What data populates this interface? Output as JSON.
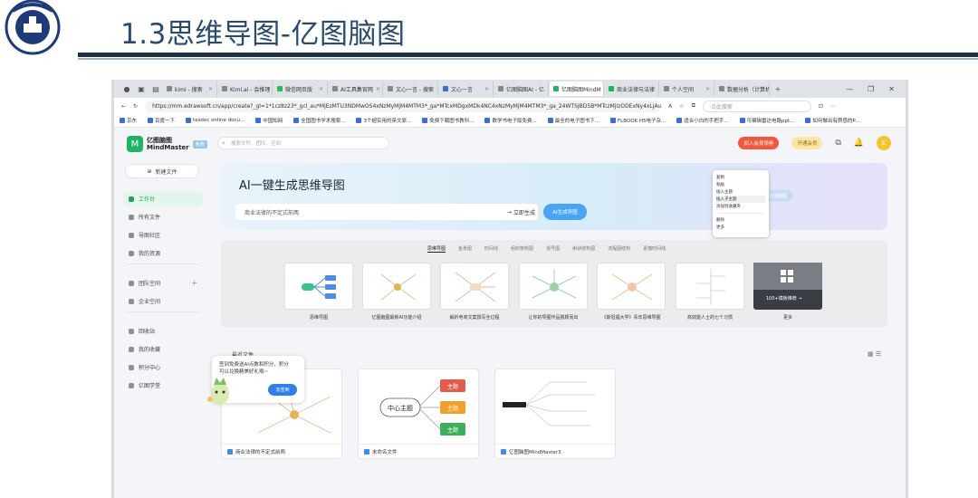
{
  "slide": {
    "title": "1.3思维导图-亿图脑图"
  },
  "browser": {
    "tabs": [
      {
        "label": "kimi - 搜索"
      },
      {
        "label": "Kimi.ai - 会推理"
      },
      {
        "label": "微信网页版"
      },
      {
        "label": "AI工具集官网"
      },
      {
        "label": "文心一言 - 搜索"
      },
      {
        "label": "文心一言"
      },
      {
        "label": "亿图脑图AI - 亿"
      },
      {
        "label": "亿图脑图MindM",
        "active": true
      },
      {
        "label": "商业法律与法律"
      },
      {
        "label": "个人空间"
      },
      {
        "label": "数据分析（计算机"
      }
    ],
    "url": "https://mm.edrawsoft.cn/app/create?_gl=1*1cz8z23*_gcl_au*MjEzMTU3NDMwOS4xNzMyMjM4MTM3*_ga*MTcxMDgxMDk4NC4xNzMyMjM4MTM3*_ga_24WTSJBD5B*MTczMjIzODExNy4xLjAuMTcz...",
    "find_placeholder": "点此搜索",
    "bookmarks": [
      "京东",
      "百度一下",
      "tesdoc online docu...",
      "中国知网",
      "全国图书学术搜索...",
      "3个超实用的英文原...",
      "免费下载图书教科...",
      "数学书电子版免费...",
      "最全的电子图书下...",
      "FLBOOK·H5电子杂...",
      "适合小白的手把手...",
      "可编辑雷达电路ppt...",
      "如何做出有质感的P..."
    ]
  },
  "app": {
    "brand_name": "亿图脑图\nMindMaster",
    "brand_tag": "免费",
    "search_placeholder": "搜索文件、团队、空间",
    "top_right": {
      "upgrade_label": "加入会员领券",
      "member_label": "开通会员",
      "avatar_letter": "E"
    },
    "sidebar": {
      "new_file": "新建文件",
      "items": [
        {
          "label": "工作台",
          "active": true
        },
        {
          "label": "所有文件"
        },
        {
          "label": "导图社区"
        },
        {
          "label": "我的资源"
        },
        {
          "label": "团队空间"
        },
        {
          "label": "企业空间"
        },
        {
          "label": "回收站"
        },
        {
          "label": "我的收藏"
        },
        {
          "label": "积分中心"
        },
        {
          "label": "亿图学堂"
        }
      ]
    },
    "banner": {
      "title": "AI一键生成思维导图",
      "prompt_value": "商业法律的不定式前两",
      "generate_label": "立即生成",
      "ai_button": "AI生成导图",
      "side_button": "亿图脑图"
    },
    "context_menu": [
      "复制",
      "粘贴",
      "插入主题",
      "插入子主题",
      "添加到收藏夹",
      "删除",
      "更多"
    ],
    "template_tabs": [
      "思维导图",
      "鱼骨图",
      "时间线",
      "组织架构图",
      "括号图",
      "树状结构图",
      "流程图结构",
      "素描时间线"
    ],
    "templates": [
      {
        "label": "思维导图"
      },
      {
        "label": "亿图脑图最新AI功能介绍"
      },
      {
        "label": "解析电商文案撰写全过程"
      },
      {
        "label": "让你的导图作品脱颖而出"
      },
      {
        "label": "《斯坦福大学》青年思维导图"
      },
      {
        "label": "高效能人士的七个习惯"
      },
      {
        "label": "更多",
        "more_text": "100+模板推荐 →"
      }
    ],
    "recent_label": "最近文件",
    "popup": {
      "text": "签到免费送AI点数和积分，积分可以兑换精美好礼哦~",
      "button": "去签到"
    },
    "files": [
      {
        "name": "商业法律的不定式前两"
      },
      {
        "name": "未命名文件",
        "center": "中心主题",
        "branches": [
          "主题",
          "主题",
          "主题"
        ]
      },
      {
        "name": "亿图脑图MindMaster3"
      }
    ]
  },
  "colors": {
    "brand_green": "#1fb364",
    "title_blue": "#2a4a6e",
    "branch_red": "#e35b4b",
    "branch_orange": "#f2a02b",
    "branch_green": "#3fae5a"
  }
}
